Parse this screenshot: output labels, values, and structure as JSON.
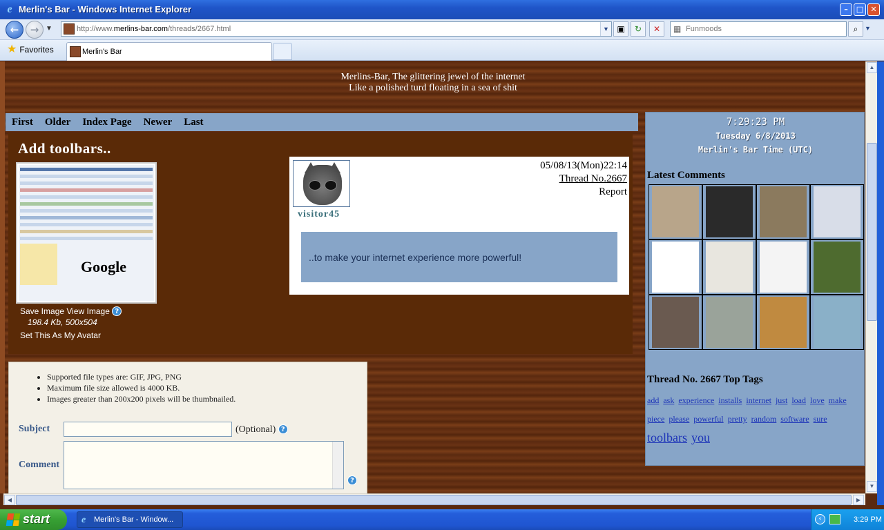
{
  "window": {
    "title": "Merlin's Bar - Windows Internet Explorer",
    "minimize": "–",
    "maximize": "□",
    "close": "✕"
  },
  "nav": {
    "back_icon": "←",
    "forward_icon": "→",
    "url_prefix": "http://www.",
    "url_domain": "merlins-bar.com",
    "url_path": "/threads/2667.html",
    "search_placeholder": "Funmoods",
    "refresh_icon": "↻",
    "stop_icon": "✕",
    "search_icon": "⌕"
  },
  "favorites": {
    "label": "Favorites",
    "tab_title": "Merlin's Bar"
  },
  "site": {
    "slogan_1": "Merlins-Bar, The glittering jewel of the internet",
    "slogan_2": "Like a polished turd floating in a sea of shit"
  },
  "pager": {
    "items": [
      "First",
      "Older",
      "Index Page",
      "Newer",
      "Last"
    ]
  },
  "thread": {
    "title": "Add toolbars..",
    "save_image": "Save Image",
    "view_image": "View Image",
    "image_info": "198.4 Kb, 500x504",
    "set_avatar": "Set This As My Avatar",
    "thumb_logo": "Google"
  },
  "post": {
    "username": "visitor45",
    "date": "05/08/13(Mon)22:14",
    "thread_no": "Thread No.2667",
    "report": "Report",
    "message": "..to make your internet experience more powerful!"
  },
  "form": {
    "rules": [
      "Supported file types are: GIF, JPG, PNG",
      "Maximum file size allowed is 4000 KB.",
      "Images greater than 200x200 pixels will be thumbnailed."
    ],
    "subject_label": "Subject",
    "subject_value": "",
    "optional": "(Optional)",
    "comment_label": "Comment",
    "comment_value": ""
  },
  "sidebar": {
    "time": "7:29:23 PM",
    "date": "Tuesday 6/8/2013",
    "zone": "Merlin's Bar Time (UTC)",
    "latest_comments": "Latest Comments",
    "top_tags_title": "Thread No. 2667 Top Tags",
    "tags": [
      "add",
      "ask",
      "experience",
      "installs",
      "internet",
      "just",
      "load",
      "love",
      "make",
      "piece",
      "please",
      "powerful",
      "pretty",
      "random",
      "software",
      "sure"
    ],
    "big_tags": [
      "toolbars",
      "you"
    ],
    "thumbnail_colors": [
      "#b8a58a",
      "#2a2a2a",
      "#8b7a5e",
      "#d8dde8",
      "#ffffff",
      "#e8e6df",
      "#f4f4f4",
      "#4e6b2f",
      "#6a5a50",
      "#9aa39a",
      "#c08a40",
      "#8ab0c8"
    ]
  },
  "taskbar": {
    "start": "start",
    "task_title": "Merlin's Bar - Window...",
    "clock": "3:29 PM",
    "tray_chevron": "‹"
  }
}
